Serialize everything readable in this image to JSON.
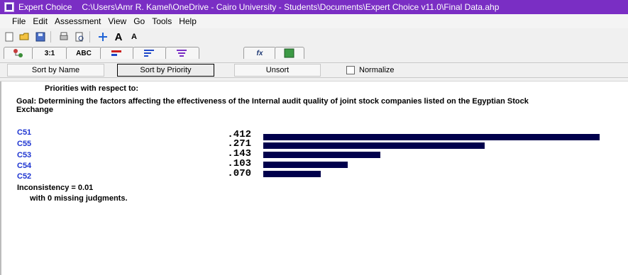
{
  "window": {
    "app_title": "Expert Choice",
    "file_path": "C:\\Users\\Amr R. Kamel\\OneDrive - Cairo University - Students\\Documents\\Expert Choice v11.0\\Final Data.ahp"
  },
  "menu": [
    "File",
    "Edit",
    "Assessment",
    "View",
    "Go",
    "Tools",
    "Help"
  ],
  "toolbar": {
    "icons": [
      "new-file-icon",
      "open-folder-icon",
      "save-icon",
      "print-icon",
      "print-preview-icon",
      "add-node-icon",
      "font-larger-icon",
      "font-smaller-icon"
    ],
    "labels": {
      "font_larger": "A",
      "font_smaller": "A"
    }
  },
  "mode_tabs": [
    {
      "name": "hierarchy-tab",
      "label": ""
    },
    {
      "name": "pairwise-numerical-tab",
      "label": "3:1"
    },
    {
      "name": "pairwise-verbal-tab",
      "label": "ABC"
    },
    {
      "name": "graphical-tab",
      "label": ""
    },
    {
      "name": "data-grid-tab",
      "label": ""
    },
    {
      "name": "synthesis-tab",
      "label": ""
    },
    {
      "name": "formula-tab",
      "label": "fx"
    },
    {
      "name": "ratings-tab",
      "label": ""
    }
  ],
  "sort_bar": {
    "sort_by_name": "Sort by Name",
    "sort_by_priority": "Sort by Priority",
    "unsort": "Unsort",
    "normalize": "Normalize",
    "normalize_checked": false
  },
  "report": {
    "title": "Priorities with respect to:",
    "goal": "Goal: Determining the factors affecting the effectiveness of the Internal audit quality of joint stock companies listed on the Egyptian Stock Exchange",
    "criteria": [
      {
        "label": "C51",
        "value": ".412",
        "priority": 0.412
      },
      {
        "label": "C55",
        "value": ".271",
        "priority": 0.271
      },
      {
        "label": "C53",
        "value": ".143",
        "priority": 0.143
      },
      {
        "label": "C54",
        "value": ".103",
        "priority": 0.103
      },
      {
        "label": "C52",
        "value": ".070",
        "priority": 0.07
      }
    ],
    "inconsistency": "Inconsistency = 0.01",
    "missing": "with 0  missing judgments."
  },
  "colors": {
    "titlebar": "#7a2ec4",
    "criterion_label": "#1d34d1",
    "bar": "#00004c"
  }
}
